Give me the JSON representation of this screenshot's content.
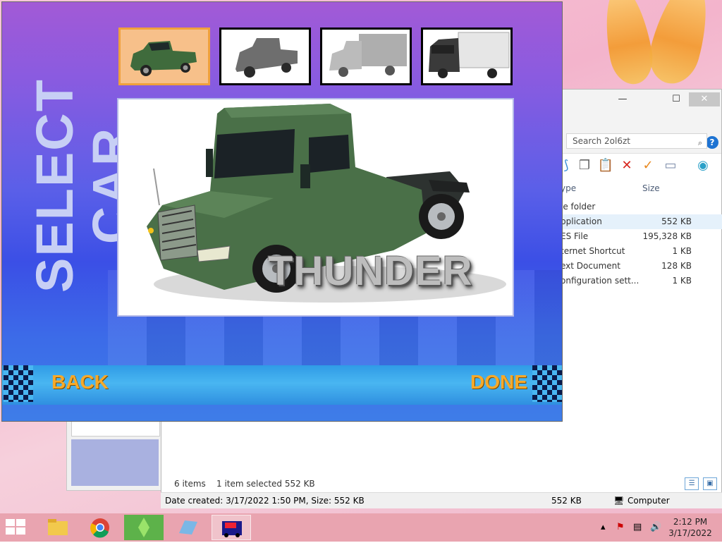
{
  "game": {
    "heading": "SELECT CAR",
    "selected_car_name": "THUNDER",
    "back_label": "BACK",
    "done_label": "DONE",
    "thumbnails": [
      {
        "state": "selected"
      },
      {
        "state": "locked"
      },
      {
        "state": "locked"
      },
      {
        "state": "locked"
      }
    ]
  },
  "explorer": {
    "search_placeholder": "Search 2ol6zt",
    "columns": {
      "type": "ype",
      "size": "Size"
    },
    "files": [
      {
        "type": "le folder",
        "size": ""
      },
      {
        "type": "pplication",
        "size": "552 KB",
        "selected": true
      },
      {
        "type": "ES File",
        "size": "195,328 KB"
      },
      {
        "type": "ternet Shortcut",
        "size": "1 KB"
      },
      {
        "type": "ext Document",
        "size": "128 KB"
      },
      {
        "type": "onfiguration sett...",
        "size": "1 KB"
      }
    ],
    "status_items": "6 items",
    "status_selected": "1 item selected  552 KB",
    "info_details": "Date created: 3/17/2022 1:50 PM, Size: 552 KB",
    "info_size": "552 KB",
    "info_location": "Computer"
  },
  "taskbar": {
    "time": "2:12 PM",
    "date": "3/17/2022"
  },
  "colors": {
    "accent_button": "#f6a92a",
    "selected_thumb_border": "#f0a13c"
  }
}
